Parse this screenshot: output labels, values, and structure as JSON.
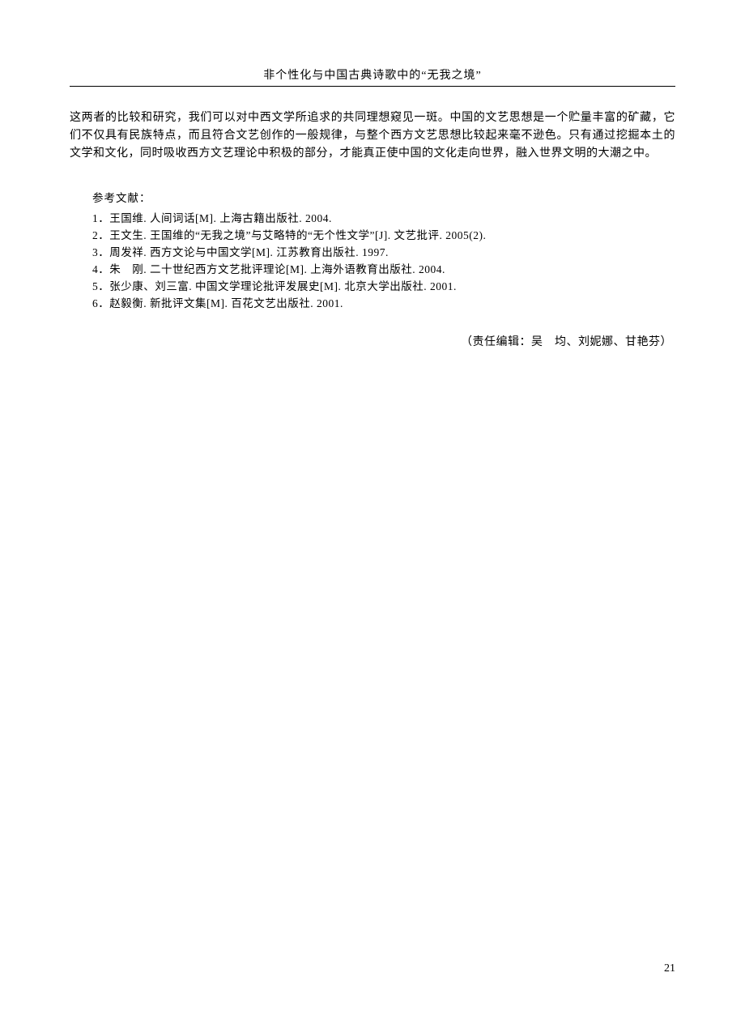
{
  "header": {
    "running_title": "非个性化与中国古典诗歌中的“无我之境”"
  },
  "body": {
    "paragraph": "这两者的比较和研究，我们可以对中西文学所追求的共同理想窥见一斑。中国的文艺思想是一个贮量丰富的矿藏，它们不仅具有民族特点，而且符合文艺创作的一般规律，与整个西方文艺思想比较起来毫不逊色。只有通过挖掘本土的文学和文化，同时吸收西方文艺理论中积极的部分，才能真正使中国的文化走向世界，融入世界文明的大潮之中。"
  },
  "references": {
    "heading": "参考文献：",
    "items": [
      "1．王国维. 人间词话[M]. 上海古籍出版社. 2004.",
      "2．王文生. 王国维的“无我之境”与艾略特的“无个性文学”[J]. 文艺批评. 2005(2).",
      "3．周发祥. 西方文论与中国文学[M]. 江苏教育出版社. 1997.",
      "4．朱　刚. 二十世纪西方文艺批评理论[M]. 上海外语教育出版社. 2004.",
      "5．张少康、刘三富. 中国文学理论批评发展史[M]. 北京大学出版社. 2001.",
      "6．赵毅衡. 新批评文集[M]. 百花文艺出版社. 2001."
    ]
  },
  "editors": {
    "line": "（责任编辑：吴　均、刘妮娜、甘艳芬）"
  },
  "page_number": "21"
}
